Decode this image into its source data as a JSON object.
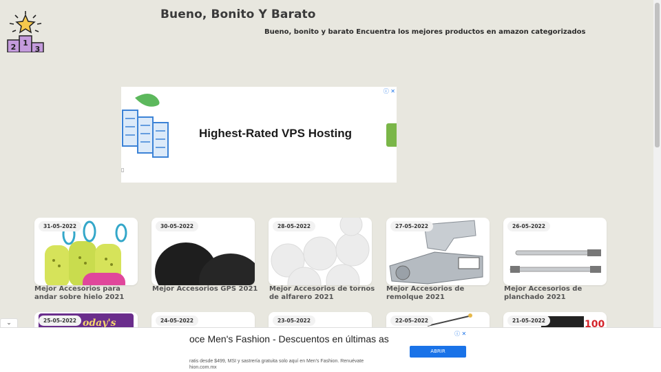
{
  "header": {
    "site_title": "Bueno, Bonito Y Barato",
    "tagline": "Bueno, bonito y barato Encuentra los mejores productos en amazon categorizados",
    "logo_icon": "podium-star-icon"
  },
  "top_ad": {
    "headline": "Highest-Rated VPS Hosting",
    "choices_icon": "ⓘ ✕"
  },
  "posts": [
    {
      "date": "31-05-2022",
      "title": "Mejor Accesorios para andar sobre hielo 2021"
    },
    {
      "date": "30-05-2022",
      "title": "Mejor Accesorios GPS 2021"
    },
    {
      "date": "28-05-2022",
      "title": "Mejor Accesorios de tornos de alfarero 2021"
    },
    {
      "date": "27-05-2022",
      "title": "Mejor Accesorios de remolque 2021"
    },
    {
      "date": "26-05-2022",
      "title": "Mejor Accesorios de planchado 2021"
    },
    {
      "date": "25-05-2022",
      "title": ""
    },
    {
      "date": "24-05-2022",
      "title": ""
    },
    {
      "date": "23-05-2022",
      "title": ""
    },
    {
      "date": "22-05-2022",
      "title": ""
    },
    {
      "date": "21-05-2022",
      "title": ""
    }
  ],
  "bottom_ad": {
    "headline": "oce Men's Fashion - Descuentos en últimas as",
    "subtext": "ratis desde $499, MSI y sastrería gratuita solo aquí en Men's Fashion. Renuévate hion.com.mx",
    "button": "ABRIR",
    "choices_icon": "ⓘ ✕",
    "collapse_icon": "chevron-down-icon"
  },
  "colors": {
    "background": "#e8e7df",
    "ad_button": "#1a73e8",
    "logo_purple": "#c49bdc",
    "logo_star": "#f5c84c"
  }
}
